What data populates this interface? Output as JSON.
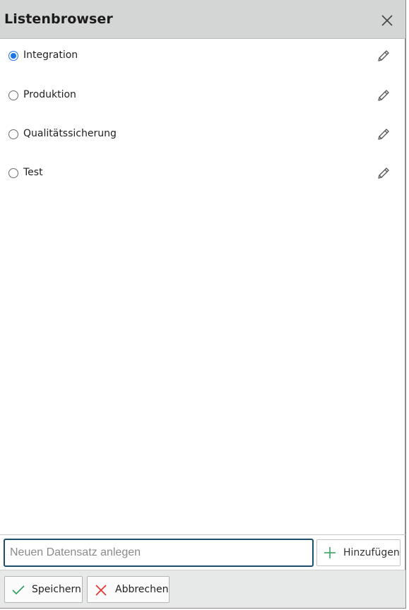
{
  "dialog": {
    "title": "Listenbrowser",
    "close_icon": "close-icon"
  },
  "list": {
    "items": [
      {
        "label": "Integration",
        "selected": true
      },
      {
        "label": "Produktion",
        "selected": false
      },
      {
        "label": "Qualitätssicherung",
        "selected": false
      },
      {
        "label": "Test",
        "selected": false
      }
    ],
    "edit_icon": "pencil-icon"
  },
  "new_entry": {
    "placeholder": "Neuen Datensatz anlegen",
    "value": "",
    "add_label": "Hinzufügen",
    "add_icon": "plus-icon"
  },
  "footer": {
    "save_label": "Speichern",
    "save_icon": "checkmark-icon",
    "cancel_label": "Abbrechen",
    "cancel_icon": "x-icon"
  },
  "colors": {
    "titlebar_bg": "#d4d6d6",
    "accent": "#1a73e8",
    "input_border": "#1d4e6b",
    "check_green": "#2e9e5b",
    "cancel_red": "#e0322b",
    "plus_green": "#3aa35f"
  }
}
